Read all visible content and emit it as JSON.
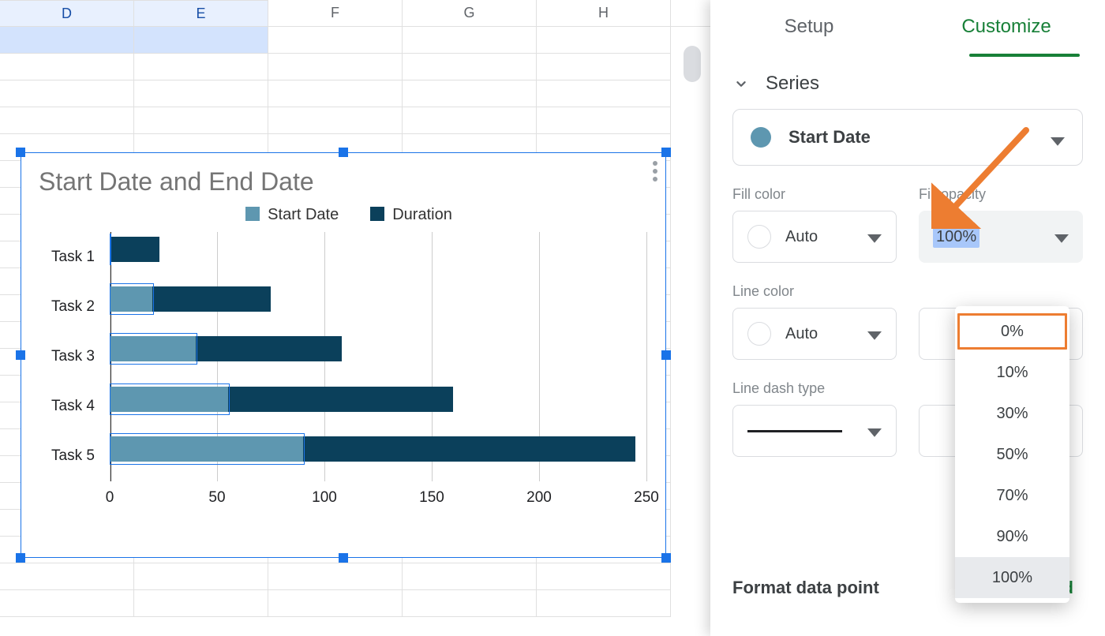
{
  "spreadsheet": {
    "columns": [
      "D",
      "E",
      "F",
      "G",
      "H"
    ]
  },
  "chart_data": {
    "type": "bar",
    "title": "Start Date and End Date",
    "orientation": "horizontal",
    "stacked": true,
    "categories": [
      "Task 1",
      "Task 2",
      "Task 3",
      "Task 4",
      "Task 5"
    ],
    "series": [
      {
        "name": "Start Date",
        "color": "#5E97B0",
        "values": [
          0,
          20,
          40,
          55,
          90
        ]
      },
      {
        "name": "Duration",
        "color": "#0B405B",
        "values": [
          23,
          55,
          68,
          105,
          155
        ]
      }
    ],
    "xlabel": "",
    "ylabel": "",
    "xlim": [
      0,
      250
    ],
    "x_ticks": [
      0,
      50,
      100,
      150,
      200,
      250
    ]
  },
  "panel": {
    "tabs": {
      "setup": "Setup",
      "customize": "Customize",
      "active": "customize"
    },
    "section": "Series",
    "series_select": "Start Date",
    "labels": {
      "fill_color": "Fill color",
      "fill_opacity": "Fill opacity",
      "line_color": "Line color",
      "line_dash": "Line dash type",
      "fdp": "Format data point",
      "add": "Add"
    },
    "fill_color": "Auto",
    "fill_opacity": "100%",
    "line_color": "Auto",
    "opacity_options": [
      "0%",
      "10%",
      "30%",
      "50%",
      "70%",
      "90%",
      "100%"
    ],
    "opacity_highlight": "0%",
    "opacity_selected": "100%"
  }
}
